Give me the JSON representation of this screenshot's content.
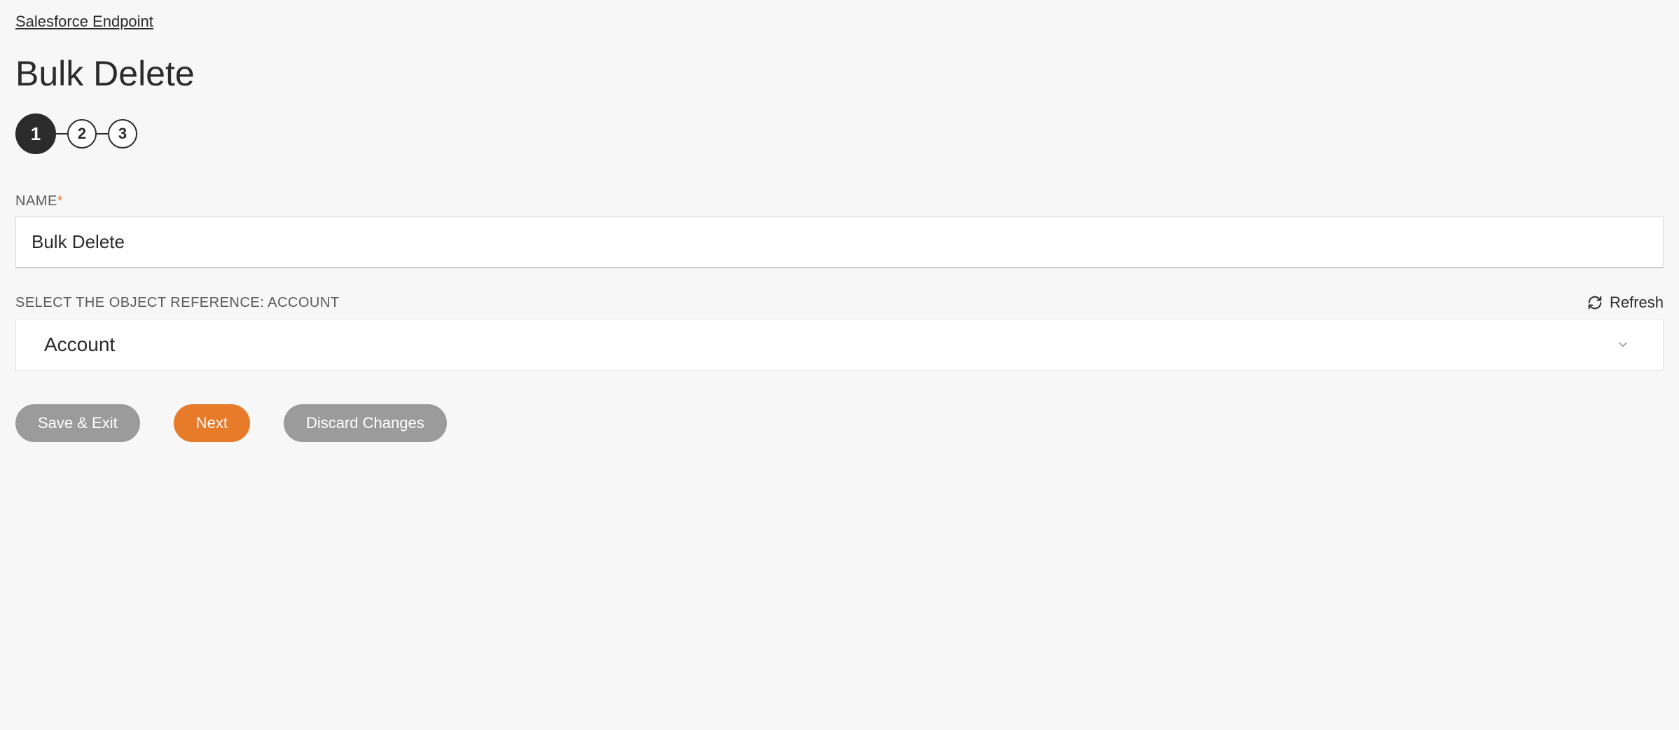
{
  "breadcrumb": {
    "label": "Salesforce Endpoint"
  },
  "page": {
    "title": "Bulk Delete"
  },
  "stepper": {
    "current": 1,
    "steps": [
      "1",
      "2",
      "3"
    ]
  },
  "fields": {
    "name": {
      "label": "NAME",
      "required_marker": "*",
      "value": "Bulk Delete"
    },
    "object_reference": {
      "label": "SELECT THE OBJECT REFERENCE: ACCOUNT",
      "selected": "Account",
      "refresh_label": "Refresh"
    }
  },
  "buttons": {
    "save_exit": "Save & Exit",
    "next": "Next",
    "discard": "Discard Changes"
  }
}
